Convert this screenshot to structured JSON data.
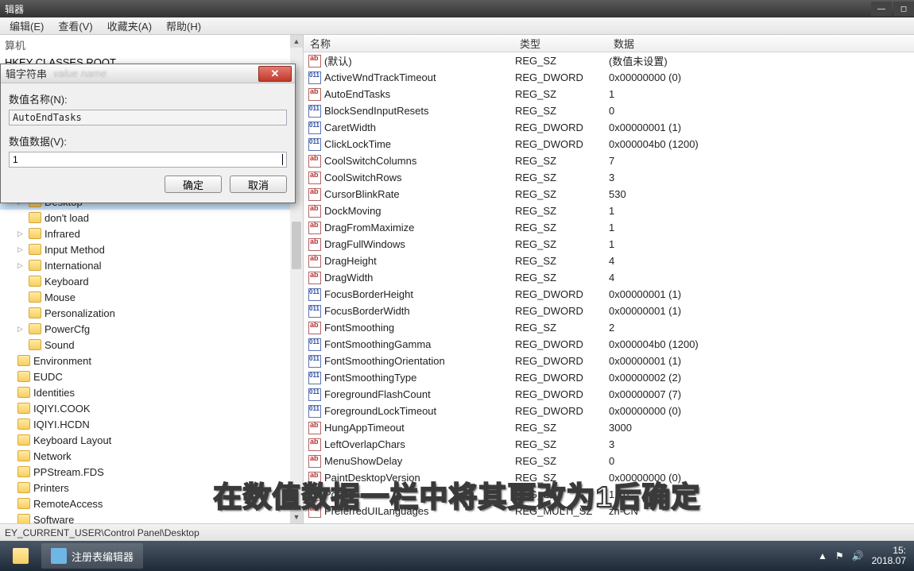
{
  "window": {
    "title": "辑器"
  },
  "menubar": {
    "edit": "编辑(E)",
    "view": "查看(V)",
    "favorites": "收藏夹(A)",
    "help": "帮助(H)"
  },
  "tree": {
    "computer": "算机",
    "root": "HKEY CLASSES ROOT",
    "items": [
      {
        "label": "Desktop",
        "selected": true,
        "expander": "▷",
        "pad": 1
      },
      {
        "label": "don't load",
        "expander": "",
        "pad": 1
      },
      {
        "label": "Infrared",
        "expander": "▷",
        "pad": 1
      },
      {
        "label": "Input Method",
        "expander": "▷",
        "pad": 1
      },
      {
        "label": "International",
        "expander": "▷",
        "pad": 1
      },
      {
        "label": "Keyboard",
        "expander": "",
        "pad": 1
      },
      {
        "label": "Mouse",
        "expander": "",
        "pad": 1
      },
      {
        "label": "Personalization",
        "expander": "",
        "pad": 1
      },
      {
        "label": "PowerCfg",
        "expander": "▷",
        "pad": 1
      },
      {
        "label": "Sound",
        "expander": "",
        "pad": 1
      },
      {
        "label": "Environment",
        "expander": "",
        "pad": 0
      },
      {
        "label": "EUDC",
        "expander": "",
        "pad": 0
      },
      {
        "label": "Identities",
        "expander": "",
        "pad": 0
      },
      {
        "label": "IQIYI.COOK",
        "expander": "",
        "pad": 0
      },
      {
        "label": "IQIYI.HCDN",
        "expander": "",
        "pad": 0
      },
      {
        "label": "Keyboard Layout",
        "expander": "",
        "pad": 0
      },
      {
        "label": "Network",
        "expander": "",
        "pad": 0
      },
      {
        "label": "PPStream.FDS",
        "expander": "",
        "pad": 0
      },
      {
        "label": "Printers",
        "expander": "",
        "pad": 0
      },
      {
        "label": "RemoteAccess",
        "expander": "",
        "pad": 0
      },
      {
        "label": "Software",
        "expander": "",
        "pad": 0
      }
    ]
  },
  "list": {
    "headers": {
      "name": "名称",
      "type": "类型",
      "data": "数据"
    },
    "rows": [
      {
        "icon": "str",
        "name": "(默认)",
        "type": "REG_SZ",
        "data": "(数值未设置)"
      },
      {
        "icon": "dword",
        "name": "ActiveWndTrackTimeout",
        "type": "REG_DWORD",
        "data": "0x00000000 (0)"
      },
      {
        "icon": "str",
        "name": "AutoEndTasks",
        "type": "REG_SZ",
        "data": "1"
      },
      {
        "icon": "dword",
        "name": "BlockSendInputResets",
        "type": "REG_SZ",
        "data": "0"
      },
      {
        "icon": "dword",
        "name": "CaretWidth",
        "type": "REG_DWORD",
        "data": "0x00000001 (1)"
      },
      {
        "icon": "dword",
        "name": "ClickLockTime",
        "type": "REG_DWORD",
        "data": "0x000004b0 (1200)"
      },
      {
        "icon": "str",
        "name": "CoolSwitchColumns",
        "type": "REG_SZ",
        "data": "7"
      },
      {
        "icon": "str",
        "name": "CoolSwitchRows",
        "type": "REG_SZ",
        "data": "3"
      },
      {
        "icon": "str",
        "name": "CursorBlinkRate",
        "type": "REG_SZ",
        "data": "530"
      },
      {
        "icon": "str",
        "name": "DockMoving",
        "type": "REG_SZ",
        "data": "1"
      },
      {
        "icon": "str",
        "name": "DragFromMaximize",
        "type": "REG_SZ",
        "data": "1"
      },
      {
        "icon": "str",
        "name": "DragFullWindows",
        "type": "REG_SZ",
        "data": "1"
      },
      {
        "icon": "str",
        "name": "DragHeight",
        "type": "REG_SZ",
        "data": "4"
      },
      {
        "icon": "str",
        "name": "DragWidth",
        "type": "REG_SZ",
        "data": "4"
      },
      {
        "icon": "dword",
        "name": "FocusBorderHeight",
        "type": "REG_DWORD",
        "data": "0x00000001 (1)"
      },
      {
        "icon": "dword",
        "name": "FocusBorderWidth",
        "type": "REG_DWORD",
        "data": "0x00000001 (1)"
      },
      {
        "icon": "str",
        "name": "FontSmoothing",
        "type": "REG_SZ",
        "data": "2"
      },
      {
        "icon": "dword",
        "name": "FontSmoothingGamma",
        "type": "REG_DWORD",
        "data": "0x000004b0 (1200)"
      },
      {
        "icon": "dword",
        "name": "FontSmoothingOrientation",
        "type": "REG_DWORD",
        "data": "0x00000001 (1)"
      },
      {
        "icon": "dword",
        "name": "FontSmoothingType",
        "type": "REG_DWORD",
        "data": "0x00000002 (2)"
      },
      {
        "icon": "dword",
        "name": "ForegroundFlashCount",
        "type": "REG_DWORD",
        "data": "0x00000007 (7)"
      },
      {
        "icon": "dword",
        "name": "ForegroundLockTimeout",
        "type": "REG_DWORD",
        "data": "0x00000000 (0)"
      },
      {
        "icon": "str",
        "name": "HungAppTimeout",
        "type": "REG_SZ",
        "data": "3000"
      },
      {
        "icon": "str",
        "name": "LeftOverlapChars",
        "type": "REG_SZ",
        "data": "3"
      },
      {
        "icon": "str",
        "name": "MenuShowDelay",
        "type": "REG_SZ",
        "data": "0"
      },
      {
        "icon": "str",
        "name": "PaintDesktopVersion",
        "type": "REG_SZ",
        "data": "0x00000000 (0)"
      },
      {
        "icon": "str",
        "name": "Popgrf",
        "type": "REG_SZ",
        "data": "1:10"
      },
      {
        "icon": "str",
        "name": "PreferredUILanguages",
        "type": "REG_MULTI_SZ",
        "data": "zh-CN"
      }
    ]
  },
  "status": {
    "path": "EY_CURRENT_USER\\Control Panel\\Desktop"
  },
  "dialog": {
    "title": "辑字符串",
    "name_label": "数值名称(N):",
    "name_value": "AutoEndTasks",
    "data_label": "数值数据(V):",
    "data_value": "1",
    "ok": "确定",
    "cancel": "取消"
  },
  "taskbar": {
    "app": "注册表编辑器",
    "time": "15:",
    "date": "2018.07"
  },
  "subtitle": "在数值数据一栏中将其更改为1后确定"
}
